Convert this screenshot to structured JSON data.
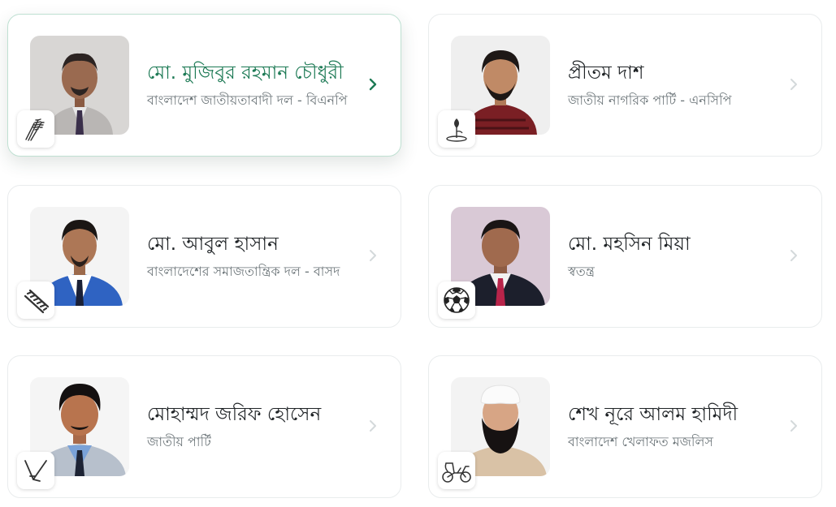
{
  "candidates": [
    {
      "name": "মো. মুজিবুর রহমান চৌধুরী",
      "party": "বাংলাদেশ জাতীয়তাবাদী দল - বিএনপি",
      "symbol_icon": "paddy-sheaf-icon",
      "active": true
    },
    {
      "name": "প্রীতম দাশ",
      "party": "জাতীয় নাগরিক পার্টি - এনসিপি",
      "symbol_icon": "water-lily-bud-icon",
      "active": false
    },
    {
      "name": "মো. আবুল হাসান",
      "party": "বাংলাদেশের সমাজতান্ত্রিক দল - বাসদ",
      "symbol_icon": "ladder-icon",
      "active": false
    },
    {
      "name": "মো. মহসিন মিয়া",
      "party": "স্বতন্ত্র",
      "symbol_icon": "football-icon",
      "active": false
    },
    {
      "name": "মোহাম্মদ জরিফ হোসেন",
      "party": "জাতীয় পার্টি",
      "symbol_icon": "plough-icon",
      "active": false
    },
    {
      "name": "শেখ নূরে আলম হামিদী",
      "party": "বাংলাদেশ খেলাফত মজলিস",
      "symbol_icon": "rickshaw-icon",
      "active": false
    }
  ],
  "colors": {
    "accent": "#1d7a55",
    "chevron_active": "#1d7a55",
    "chevron_inactive": "#d4d9db"
  }
}
